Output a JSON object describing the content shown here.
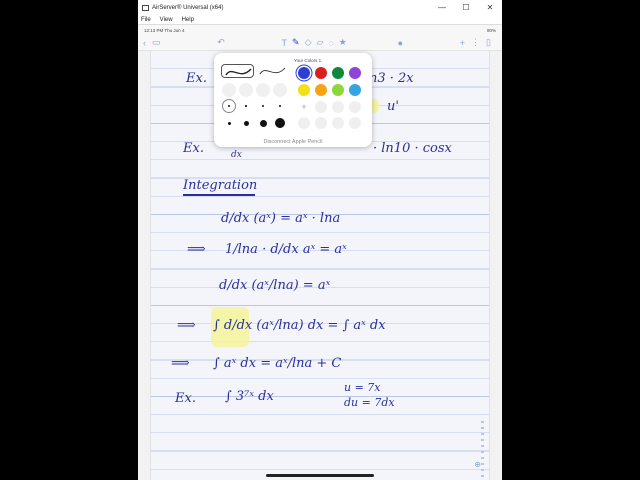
{
  "window": {
    "title": "AirServer® Universal (x64)",
    "controls": [
      "—",
      "☐",
      "✕"
    ]
  },
  "menubar": {
    "items": [
      "File",
      "View",
      "Help"
    ]
  },
  "status": {
    "time": "12:13 PM   Thu Jun 4",
    "battery": "80%"
  },
  "popup": {
    "caption": "Your Colors 1",
    "disconnect": "Disconnect Apple Pencil",
    "colors": [
      "#2b3fd6",
      "#d81f1f",
      "#0c8a3a",
      "#8e44d8",
      "#f3e019",
      "#f5a315",
      "#8fd63a",
      "#36a3e3"
    ]
  },
  "notes": {
    "ex1_label": "Ex.",
    "ex1_rest": "n3 · 2x",
    "ex1b_rest": "u'",
    "ex2_label": "Ex.",
    "ex2_small": "dx",
    "ex2_rest": "· ln10 · cosx",
    "heading": "Integration",
    "l1": "d/dx (aˣ) = aˣ · lna",
    "l2_arrow": "⟹",
    "l2": "1/lna · d/dx aˣ = aˣ",
    "l3_arrow": "⟹",
    "l3": "d/dx (aˣ/lna) = aˣ",
    "l4_arrow": "⟹",
    "l4": "∫ d/dx (aˣ/lna) dx = ∫ aˣ dx",
    "l5_arrow": "⟹",
    "l5": "∫ aˣ dx = aˣ/lna + C",
    "ex3_label": "Ex.",
    "ex3": "∫ 3⁷ˣ dx",
    "sub1": "u = 7x",
    "sub2": "du = 7dx"
  }
}
